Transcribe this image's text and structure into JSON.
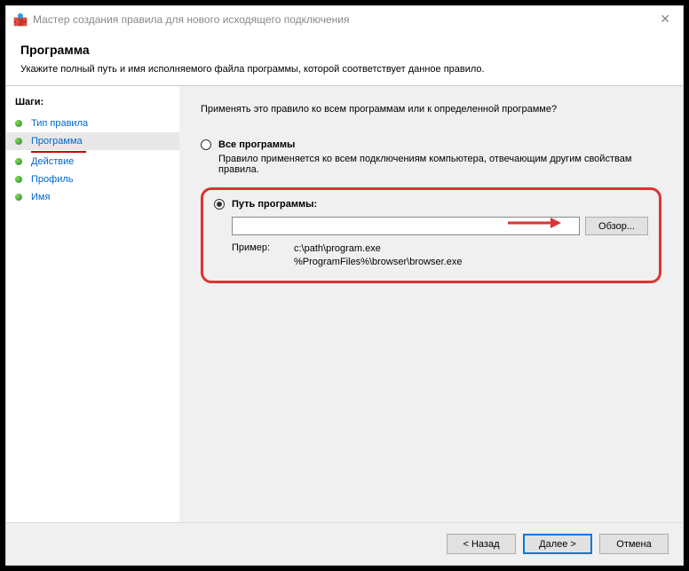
{
  "titlebar": {
    "title": "Мастер создания правила для нового исходящего подключения"
  },
  "header": {
    "title": "Программа",
    "description": "Укажите полный путь и имя исполняемого файла программы, которой соответствует данное правило."
  },
  "sidebar": {
    "header": "Шаги:",
    "items": [
      {
        "label": "Тип правила"
      },
      {
        "label": "Программа"
      },
      {
        "label": "Действие"
      },
      {
        "label": "Профиль"
      },
      {
        "label": "Имя"
      }
    ]
  },
  "content": {
    "question": "Применять это правило ко всем программам или к определенной программе?",
    "option1": {
      "label": "Все программы",
      "desc": "Правило применяется ко всем подключениям компьютера, отвечающим другим свойствам правила."
    },
    "option2": {
      "label": "Путь программы:",
      "path_value": "",
      "browse": "Обзор...",
      "example_label": "Пример:",
      "example_text1": "c:\\path\\program.exe",
      "example_text2": "%ProgramFiles%\\browser\\browser.exe"
    }
  },
  "footer": {
    "back": "< Назад",
    "next": "Далее >",
    "cancel": "Отмена"
  }
}
